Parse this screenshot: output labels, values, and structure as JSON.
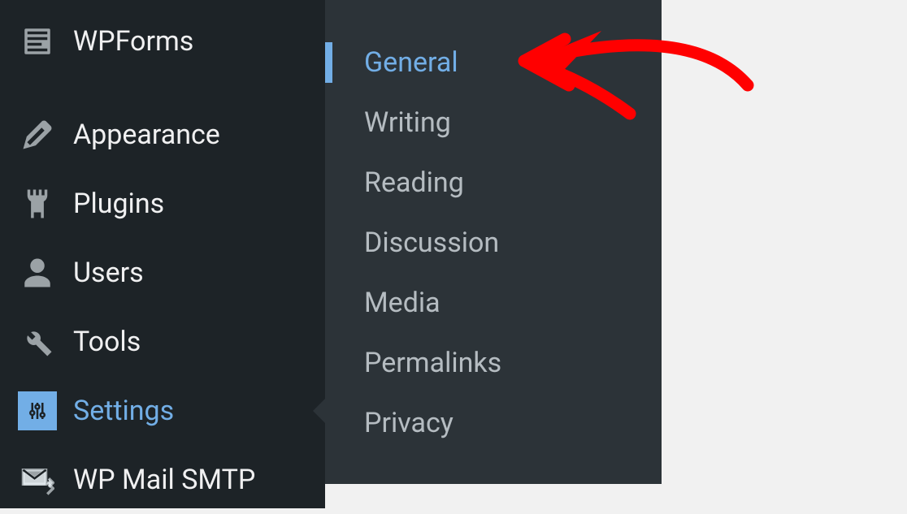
{
  "sidebar": {
    "items": [
      {
        "name": "wpforms",
        "label": "WPForms"
      },
      {
        "name": "appearance",
        "label": "Appearance"
      },
      {
        "name": "plugins",
        "label": "Plugins"
      },
      {
        "name": "users",
        "label": "Users"
      },
      {
        "name": "tools",
        "label": "Tools"
      },
      {
        "name": "settings",
        "label": "Settings"
      },
      {
        "name": "wp-mail-smtp",
        "label": "WP Mail SMTP"
      }
    ]
  },
  "submenu": {
    "items": [
      {
        "name": "general",
        "label": "General",
        "active": true
      },
      {
        "name": "writing",
        "label": "Writing"
      },
      {
        "name": "reading",
        "label": "Reading"
      },
      {
        "name": "discussion",
        "label": "Discussion"
      },
      {
        "name": "media",
        "label": "Media"
      },
      {
        "name": "permalinks",
        "label": "Permalinks"
      },
      {
        "name": "privacy",
        "label": "Privacy"
      }
    ]
  },
  "colors": {
    "accent": "#72aee6",
    "sidebar_bg": "#1d2327",
    "submenu_bg": "#2c3338",
    "annotation": "#ff0000"
  }
}
